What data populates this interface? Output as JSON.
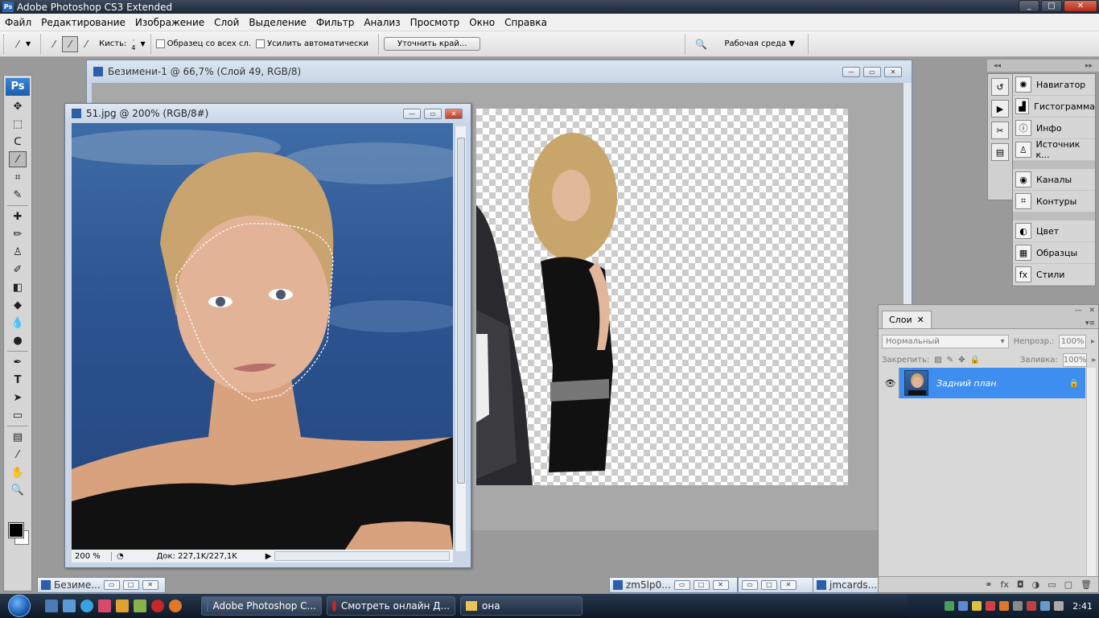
{
  "app": {
    "title": "Adobe Photoshop CS3 Extended",
    "logo": "Ps"
  },
  "menu": [
    "Файл",
    "Редактирование",
    "Изображение",
    "Слой",
    "Выделение",
    "Фильтр",
    "Анализ",
    "Просмотр",
    "Окно",
    "Справка"
  ],
  "options": {
    "brush_label": "Кисть:",
    "brush_size": "4",
    "sample_all": "Образец со всех сл.",
    "auto_enhance": "Усилить автоматически",
    "refine_edge": "Уточнить край...",
    "workspace": "Рабочая среда"
  },
  "doc1": {
    "title": "Безимени-1 @ 66,7% (Слой 49, RGB/8)"
  },
  "doc2": {
    "title": "51.jpg @ 200% (RGB/8#)",
    "zoom": "200 %",
    "doc_size": "Док: 227,1K/227,1K"
  },
  "minimized": [
    {
      "label": "Безиме..."
    },
    {
      "label": "zm5lp0..."
    },
    {
      "label": "jmcards..."
    }
  ],
  "dock": {
    "top_left": "◂◂",
    "top_right": "▸▸",
    "groups": [
      [
        {
          "icon": "navigator-icon",
          "label": "Навигатор"
        },
        {
          "icon": "histogram-icon",
          "label": "Гистограмма"
        },
        {
          "icon": "info-icon",
          "label": "Инфо"
        },
        {
          "icon": "clone-source-icon",
          "label": "Источник к..."
        }
      ],
      [
        {
          "icon": "channels-icon",
          "label": "Каналы"
        },
        {
          "icon": "paths-icon",
          "label": "Контуры"
        }
      ],
      [
        {
          "icon": "color-icon",
          "label": "Цвет"
        },
        {
          "icon": "swatches-icon",
          "label": "Образцы"
        },
        {
          "icon": "styles-icon",
          "label": "Стили"
        }
      ]
    ]
  },
  "layers": {
    "tab": "Слои",
    "blend_mode": "Нормальный",
    "opacity_label": "Непрозр.:",
    "opacity": "100%",
    "lock_label": "Закрепить:",
    "fill_label": "Заливка:",
    "fill": "100%",
    "layer_name": "Задний план"
  },
  "taskbar": {
    "buttons": [
      {
        "label": "Adobe Photoshop C...",
        "active": true
      },
      {
        "label": "Смотреть онлайн Д...",
        "active": false
      },
      {
        "label": "она",
        "active": false
      }
    ],
    "clock": "2:41"
  }
}
